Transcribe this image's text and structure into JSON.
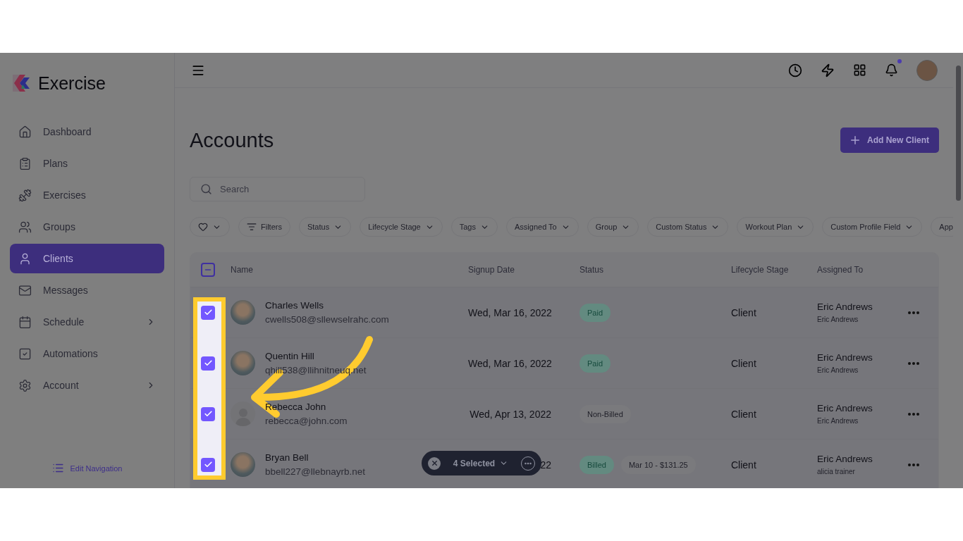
{
  "brand": {
    "name": "Exercise"
  },
  "sidebar": {
    "items": [
      {
        "label": "Dashboard",
        "selected": false,
        "submenu": false
      },
      {
        "label": "Plans",
        "selected": false,
        "submenu": false
      },
      {
        "label": "Exercises",
        "selected": false,
        "submenu": false
      },
      {
        "label": "Groups",
        "selected": false,
        "submenu": false
      },
      {
        "label": "Clients",
        "selected": true,
        "submenu": false
      },
      {
        "label": "Messages",
        "selected": false,
        "submenu": false
      },
      {
        "label": "Schedule",
        "selected": false,
        "submenu": true
      },
      {
        "label": "Automations",
        "selected": false,
        "submenu": false
      },
      {
        "label": "Account",
        "selected": false,
        "submenu": true
      }
    ],
    "edit_link": "Edit Navigation"
  },
  "topbar": {
    "notification_dot": true
  },
  "page": {
    "title": "Accounts",
    "add_button": "Add New Client",
    "search": {
      "placeholder": "Search"
    }
  },
  "filters": [
    {
      "kind": "favorite"
    },
    {
      "kind": "filters",
      "label": "Filters"
    },
    {
      "kind": "dropdown",
      "label": "Status"
    },
    {
      "kind": "dropdown",
      "label": "Lifecycle Stage"
    },
    {
      "kind": "dropdown",
      "label": "Tags"
    },
    {
      "kind": "dropdown",
      "label": "Assigned To"
    },
    {
      "kind": "dropdown",
      "label": "Group"
    },
    {
      "kind": "dropdown",
      "label": "Custom Status"
    },
    {
      "kind": "dropdown",
      "label": "Workout Plan"
    },
    {
      "kind": "dropdown",
      "label": "Custom Profile Field"
    },
    {
      "kind": "cut",
      "label": "App"
    }
  ],
  "table": {
    "select_all": {
      "indeterminate": true
    },
    "columns": [
      "Name",
      "Signup Date",
      "Status",
      "Lifecycle Stage",
      "Assigned To"
    ],
    "rows": [
      {
        "checked": true,
        "photo": true,
        "name": "Charles Wells",
        "email": "cwells508@sllewselrahc.com",
        "signup": "Wed, Mar 16, 2022",
        "status": {
          "label": "Paid",
          "kind": "paid"
        },
        "lifecycle": "Client",
        "assigned": "Eric Andrews",
        "assigned_sub": "Eric Andrews"
      },
      {
        "checked": true,
        "photo": true,
        "name": "Quentin Hill",
        "email": "qhill538@llihnitneuq.net",
        "signup": "Wed, Mar 16, 2022",
        "status": {
          "label": "Paid",
          "kind": "paid"
        },
        "lifecycle": "Client",
        "assigned": "Eric Andrews",
        "assigned_sub": "Eric Andrews"
      },
      {
        "checked": true,
        "photo": false,
        "name": "Rebecca John",
        "email": "rebecca@john.com",
        "signup": "Wed, Apr 13, 2022",
        "status": {
          "label": "Non-Billed",
          "kind": "neutral"
        },
        "lifecycle": "Client",
        "assigned": "Eric Andrews",
        "assigned_sub": "Eric Andrews"
      },
      {
        "checked": true,
        "photo": true,
        "name": "Bryan Bell",
        "email": "bbell227@llebnayrb.net",
        "signup": "22",
        "status": {
          "label": "Billed",
          "kind": "paid"
        },
        "billing": "Mar 10 - $131.25",
        "lifecycle": "Client",
        "assigned": "Eric Andrews",
        "assigned_sub": "alicia trainer"
      }
    ]
  },
  "selection_bar": {
    "label": "4 Selected"
  }
}
